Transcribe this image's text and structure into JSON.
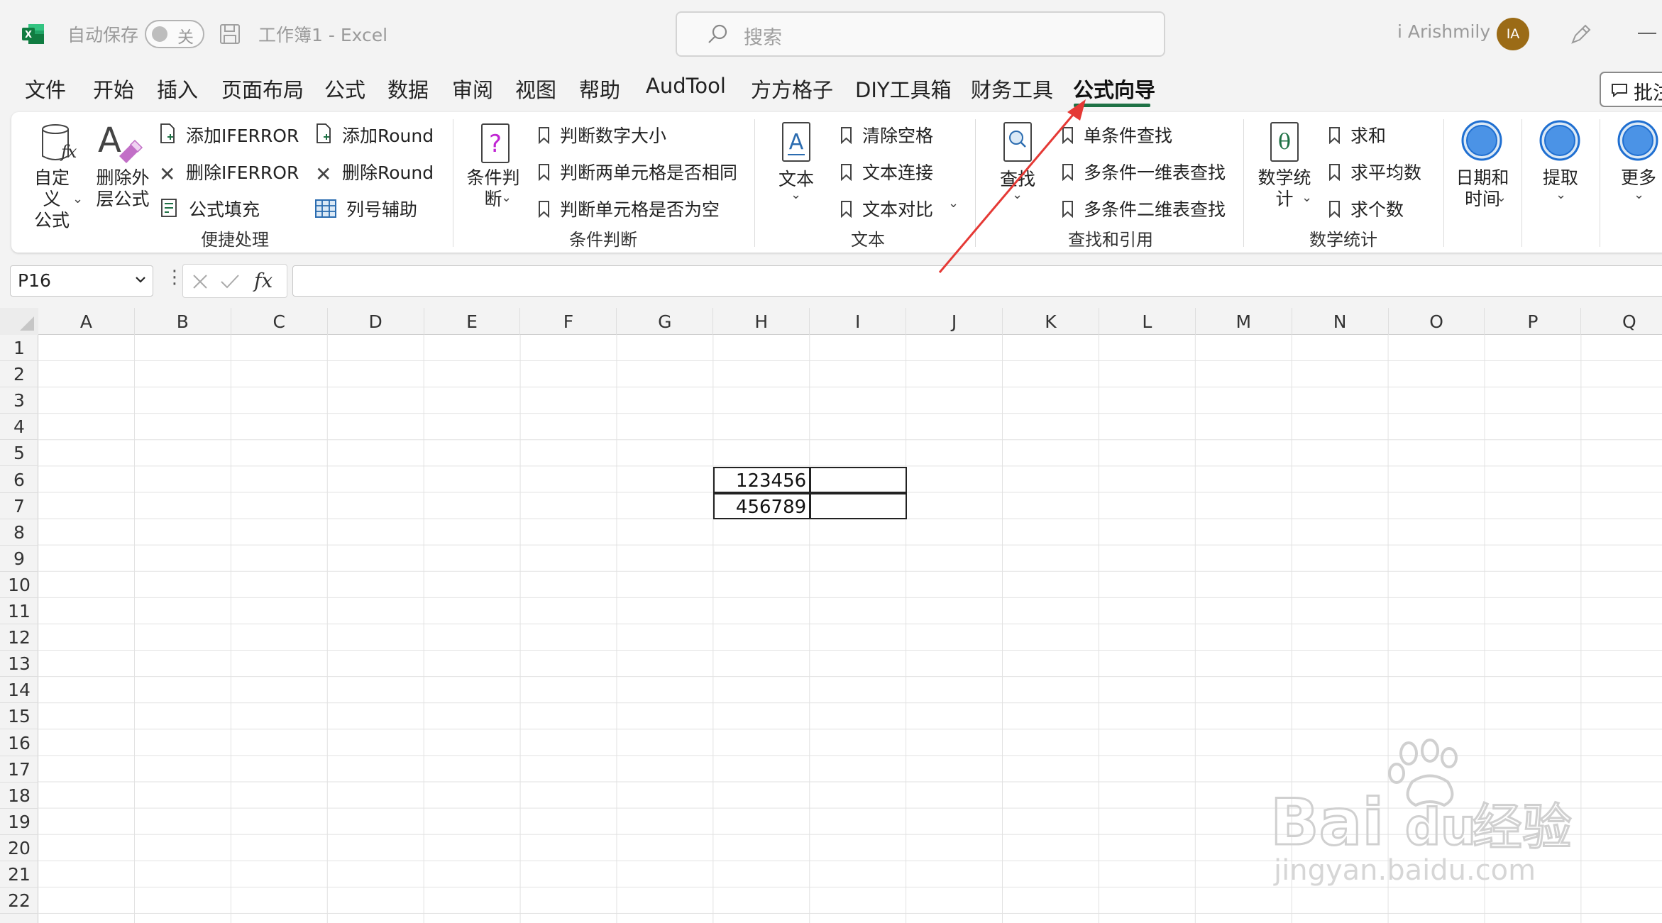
{
  "titlebar": {
    "autosave_label": "自动保存",
    "autosave_state": "关",
    "doc_title": "工作簿1  -  Excel",
    "search_placeholder": "搜索",
    "user_name": "i Arishmily",
    "avatar_initials": "IA"
  },
  "tabs": [
    "文件",
    "开始",
    "插入",
    "页面布局",
    "公式",
    "数据",
    "审阅",
    "视图",
    "帮助",
    "AudTool",
    "方方格子",
    "DIY工具箱",
    "财务工具",
    "公式向导"
  ],
  "active_tab": "公式向导",
  "comments_label": "批注",
  "ribbon": {
    "group1": {
      "label": "便捷处理",
      "big1": "自定义\n公式",
      "big2": "删除外\n层公式",
      "items": [
        "添加IFERROR",
        "删除IFERROR",
        "公式填充",
        "添加Round",
        "删除Round",
        "列号辅助"
      ]
    },
    "group2": {
      "label": "条件判断",
      "big": "条件判\n断",
      "items": [
        "判断数字大小",
        "判断两单元格是否相同",
        "判断单元格是否为空"
      ]
    },
    "group3": {
      "label": "文本",
      "big": "文本",
      "items": [
        "清除空格",
        "文本连接",
        "文本对比"
      ]
    },
    "group4": {
      "label": "查找和引用",
      "big": "查找",
      "items": [
        "单条件查找",
        "多条件一维表查找",
        "多条件二维表查找"
      ]
    },
    "group5": {
      "label": "数学统计",
      "big": "数学统\n计",
      "items": [
        "求和",
        "求平均数",
        "求个数"
      ]
    },
    "group6": {
      "big": "日期和\n时间"
    },
    "group7": {
      "big": "提取"
    },
    "group8": {
      "big": "更多"
    }
  },
  "formula_bar": {
    "name_box": "P16",
    "fx_label": "fx",
    "formula": ""
  },
  "grid": {
    "columns": [
      "A",
      "B",
      "C",
      "D",
      "E",
      "F",
      "G",
      "H",
      "I",
      "J",
      "K",
      "L",
      "M",
      "N",
      "O",
      "P",
      "Q"
    ],
    "rows": [
      "1",
      "2",
      "3",
      "4",
      "5",
      "6",
      "7",
      "8",
      "9",
      "10",
      "11",
      "12",
      "13",
      "14",
      "15",
      "16",
      "17",
      "18",
      "19",
      "20",
      "21",
      "22"
    ],
    "cells": {
      "H6": "123456",
      "H7": "456789"
    }
  },
  "watermark": {
    "text1": "Bai",
    "text2": "du",
    "text3": "经验",
    "url": "jingyan.baidu.com"
  },
  "colors": {
    "excel_green": "#1e7145",
    "annotation_red": "#e53935",
    "avatar_bg": "#9b6b16"
  }
}
